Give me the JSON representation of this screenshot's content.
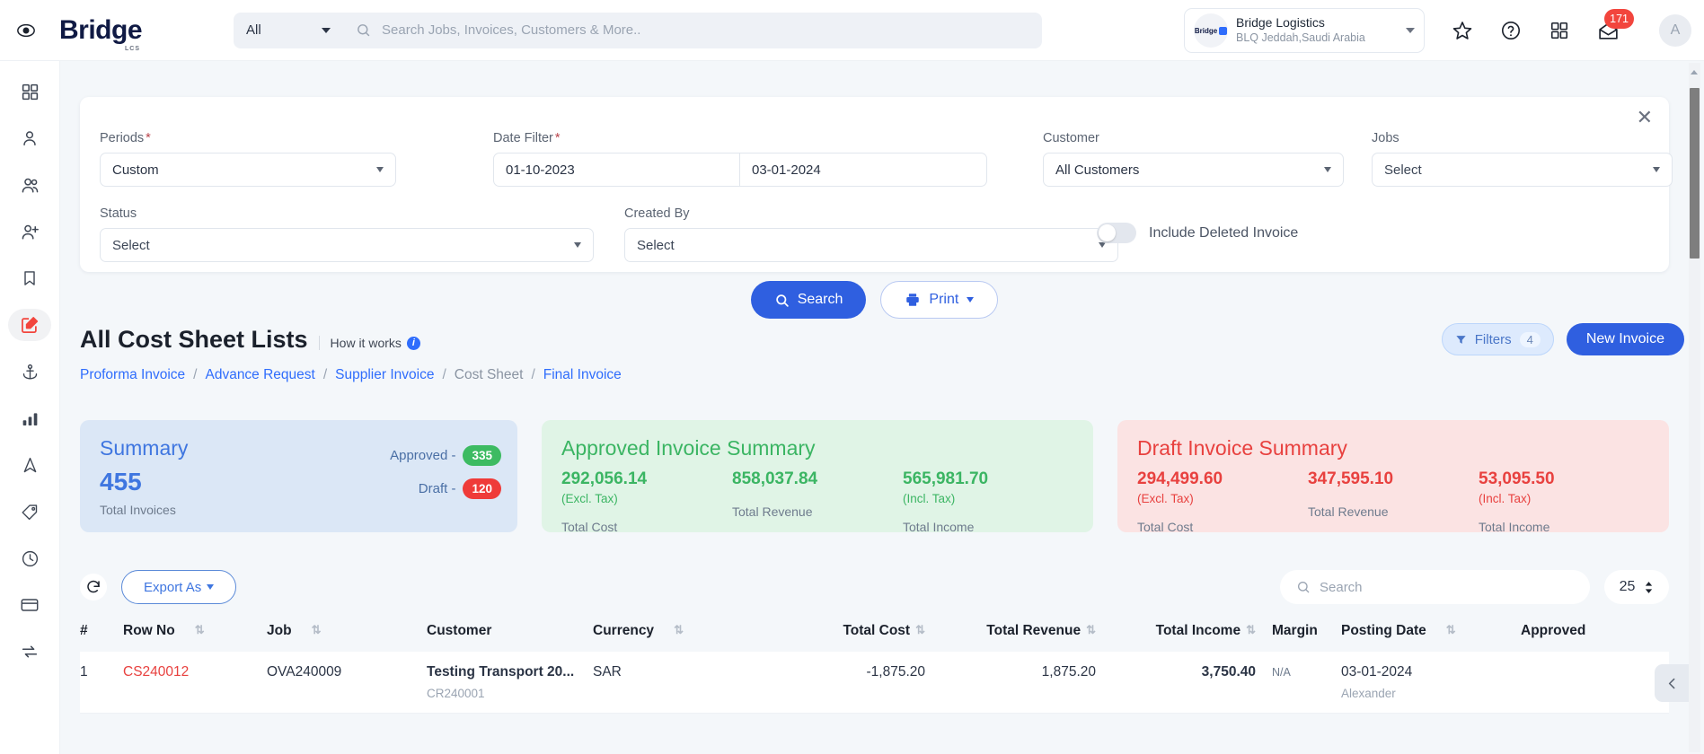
{
  "topbar": {
    "eye_icon": "eye-toggle-icon",
    "brand_name": "Bridge",
    "brand_sub": "LCS",
    "scope_label": "All",
    "search_placeholder": "Search Jobs, Invoices, Customers & More..",
    "search_value": "",
    "org_name": "Bridge Logistics",
    "org_location": "BLQ Jeddah,Saudi Arabia",
    "org_logo_text": "Bridge",
    "mail_badge": "171",
    "avatar_initial": "A",
    "icons": [
      "star-icon",
      "help-circle-icon",
      "apps-grid-icon",
      "mail-icon"
    ]
  },
  "sidebar": {
    "items": [
      {
        "name": "dashboard",
        "icon": "grid-icon",
        "active": false
      },
      {
        "name": "user",
        "icon": "user-icon",
        "active": false
      },
      {
        "name": "users",
        "icon": "users-icon",
        "active": false
      },
      {
        "name": "add-user",
        "icon": "user-plus-icon",
        "active": false
      },
      {
        "name": "bookmarks",
        "icon": "bookmark-icon",
        "active": false
      },
      {
        "name": "invoices",
        "icon": "edit-square-icon",
        "active": true
      },
      {
        "name": "shipments",
        "icon": "anchor-icon",
        "active": false
      },
      {
        "name": "reports",
        "icon": "bar-chart-icon",
        "active": false
      },
      {
        "name": "navigation",
        "icon": "navigation-icon",
        "active": false
      },
      {
        "name": "tags",
        "icon": "tag-icon",
        "active": false
      },
      {
        "name": "history",
        "icon": "clock-icon",
        "active": false
      },
      {
        "name": "payments",
        "icon": "credit-card-icon",
        "active": false
      },
      {
        "name": "transfers",
        "icon": "exchange-icon",
        "active": false
      }
    ]
  },
  "filters": {
    "close_icon": "close-icon",
    "periods_label": "Periods",
    "periods_required": "*",
    "periods_value": "Custom",
    "date_filter_label": "Date Filter",
    "date_filter_required": "*",
    "date_from": "01-10-2023",
    "date_to": "03-01-2024",
    "customer_label": "Customer",
    "customer_value": "All Customers",
    "jobs_label": "Jobs",
    "jobs_value": "Select",
    "status_label": "Status",
    "status_value": "Select",
    "created_by_label": "Created By",
    "created_by_value": "Select",
    "include_deleted_label": "Include Deleted Invoice",
    "include_deleted_on": false,
    "search_button": "Search",
    "print_button": "Print"
  },
  "page": {
    "title": "All Cost Sheet Lists",
    "how_it_works": "How it works",
    "breadcrumbs": [
      {
        "label": "Proforma Invoice",
        "current": false
      },
      {
        "label": "Advance Request",
        "current": false
      },
      {
        "label": "Supplier Invoice",
        "current": false
      },
      {
        "label": "Cost Sheet",
        "current": true
      },
      {
        "label": "Final Invoice",
        "current": false
      }
    ],
    "breadcrumb_separator": "/",
    "filters_chip_label": "Filters",
    "filters_chip_count": "4",
    "new_invoice_label": "New Invoice"
  },
  "cards": {
    "summary": {
      "title": "Summary",
      "total": "455",
      "total_label": "Total Invoices",
      "approved_label": "Approved -",
      "approved_count": "335",
      "draft_label": "Draft -",
      "draft_count": "120",
      "color": "#3f76e0"
    },
    "approved": {
      "title": "Approved Invoice Summary",
      "color": "#3bb563",
      "metrics": [
        {
          "value": "292,056.14",
          "tax": "(Excl. Tax)",
          "label": "Total Cost"
        },
        {
          "value": "858,037.84",
          "tax": "",
          "label": "Total Revenue"
        },
        {
          "value": "565,981.70",
          "tax": "(Incl. Tax)",
          "label": "Total Income"
        }
      ]
    },
    "draft": {
      "title": "Draft Invoice Summary",
      "color": "#e8413f",
      "metrics": [
        {
          "value": "294,499.60",
          "tax": "(Excl. Tax)",
          "label": "Total Cost"
        },
        {
          "value": "347,595.10",
          "tax": "",
          "label": "Total Revenue"
        },
        {
          "value": "53,095.50",
          "tax": "(Incl. Tax)",
          "label": "Total Income"
        }
      ]
    }
  },
  "table": {
    "refresh_icon": "refresh-icon",
    "export_label": "Export As",
    "search_placeholder": "Search",
    "search_value": "",
    "page_size": "25",
    "columns": [
      {
        "label": "#",
        "sortable": false
      },
      {
        "label": "Row No",
        "sortable": true
      },
      {
        "label": "Job",
        "sortable": true
      },
      {
        "label": "Customer",
        "sortable": false
      },
      {
        "label": "Currency",
        "sortable": true
      },
      {
        "label": "Total Cost",
        "sortable": true
      },
      {
        "label": "Total Revenue",
        "sortable": true
      },
      {
        "label": "Total Income",
        "sortable": true
      },
      {
        "label": "Margin",
        "sortable": false
      },
      {
        "label": "Posting Date",
        "sortable": true
      },
      {
        "label": "Approved",
        "sortable": false
      }
    ],
    "rows": [
      {
        "index": "1",
        "row_no": "CS240012",
        "job": "OVA240009",
        "customer": "Testing Transport 20...",
        "customer_sub": "CR240001",
        "currency": "SAR",
        "total_cost": "-1,875.20",
        "total_revenue": "1,875.20",
        "total_income": "3,750.40",
        "margin": "N/A",
        "posting_date": "03-01-2024",
        "posting_by": "Alexander",
        "approved": ""
      }
    ]
  },
  "collapse_tab_icon": "chevron-left-icon"
}
